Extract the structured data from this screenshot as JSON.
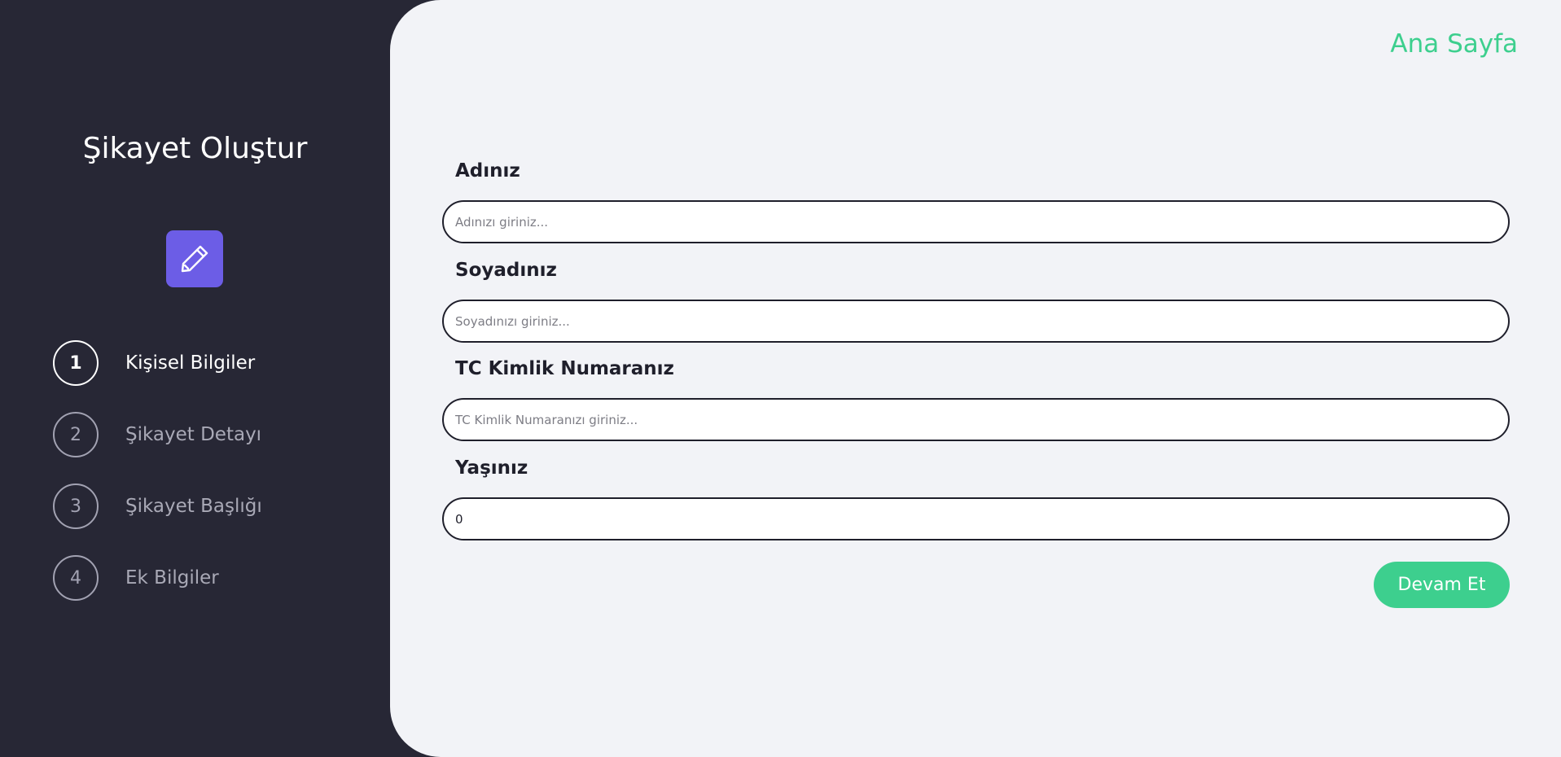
{
  "sidebar": {
    "title": "Şikayet Oluştur",
    "icon": "pencil-icon",
    "accent_color": "#6c5de6",
    "steps": [
      {
        "number": "1",
        "label": "Kişisel Bilgiler",
        "active": true
      },
      {
        "number": "2",
        "label": "Şikayet Detayı",
        "active": false
      },
      {
        "number": "3",
        "label": "Şikayet Başlığı",
        "active": false
      },
      {
        "number": "4",
        "label": "Ek Bilgiler",
        "active": false
      }
    ]
  },
  "header": {
    "home_link": "Ana Sayfa"
  },
  "form": {
    "fields": [
      {
        "label": "Adınız",
        "placeholder": "Adınızı giriniz...",
        "value": ""
      },
      {
        "label": "Soyadınız",
        "placeholder": "Soyadınızı giriniz...",
        "value": ""
      },
      {
        "label": "TC Kimlik Numaranız",
        "placeholder": "TC Kimlik Numaranızı giriniz...",
        "value": ""
      },
      {
        "label": "Yaşınız",
        "placeholder": "",
        "value": "0"
      }
    ],
    "submit_label": "Devam Et"
  },
  "colors": {
    "sidebar_bg": "#272735",
    "main_bg": "#f2f3f7",
    "accent_green": "#3dcf8e"
  }
}
